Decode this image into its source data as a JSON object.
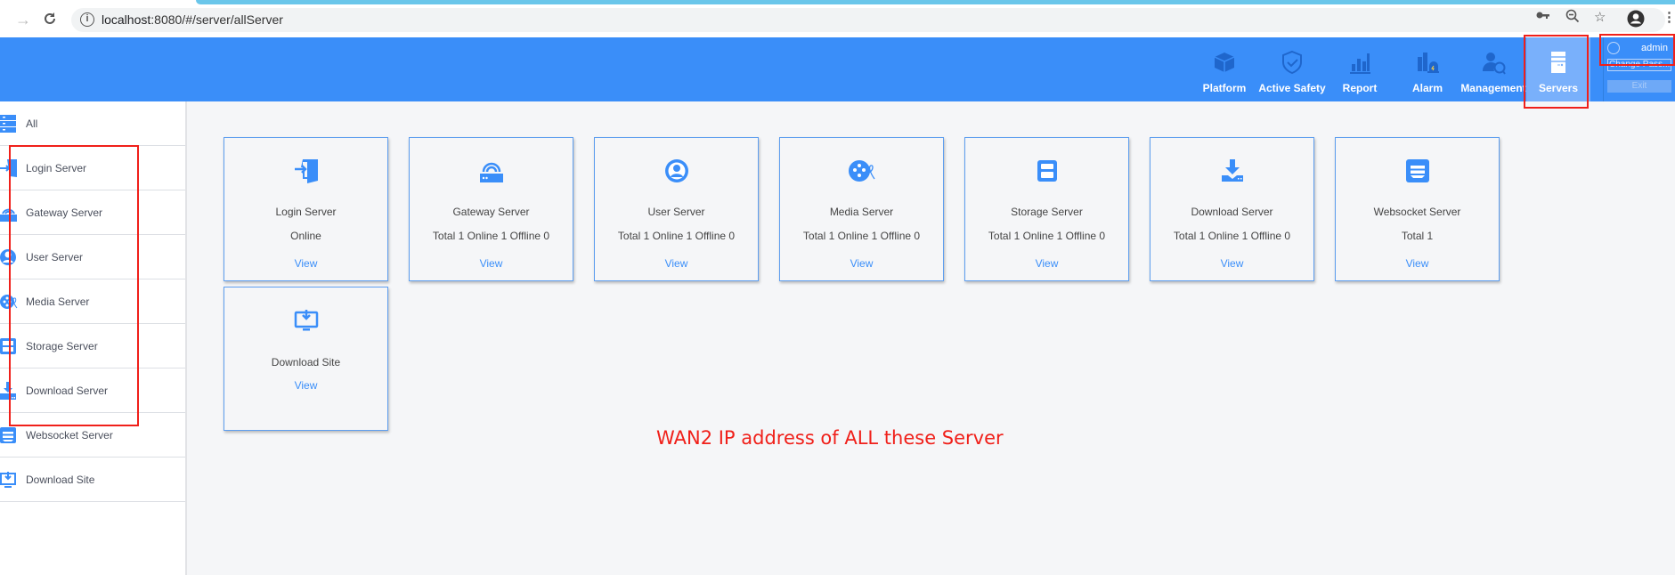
{
  "browser": {
    "url_host": "localhost",
    "url_rest": ":8080/#/server/allServer",
    "icons": [
      "back-arrow-icon",
      "reload-icon",
      "info-icon",
      "key-icon",
      "zoom-out-icon",
      "star-icon",
      "profile-icon",
      "menu-dots-icon"
    ]
  },
  "header": {
    "nav": [
      {
        "label": "Platform",
        "icon": "cube-icon"
      },
      {
        "label": "Active Safety",
        "icon": "shield-check-icon"
      },
      {
        "label": "Report",
        "icon": "bar-chart-icon"
      },
      {
        "label": "Alarm",
        "icon": "alarm-siren-icon"
      },
      {
        "label": "Management",
        "icon": "user-gauge-icon"
      },
      {
        "label": "Servers",
        "icon": "server-icon",
        "active": true
      }
    ],
    "user": {
      "name": "admin",
      "change_password": "Change Pass...",
      "exit": "Exit"
    }
  },
  "sidebar": {
    "items": [
      {
        "label": "All",
        "icon": "all-servers-icon"
      },
      {
        "label": "Login Server",
        "icon": "login-door-icon"
      },
      {
        "label": "Gateway Server",
        "icon": "router-icon"
      },
      {
        "label": "User Server",
        "icon": "user-circle-icon"
      },
      {
        "label": "Media Server",
        "icon": "film-reel-icon"
      },
      {
        "label": "Storage Server",
        "icon": "floppy-icon"
      },
      {
        "label": "Download Server",
        "icon": "download-tray-icon"
      },
      {
        "label": "Websocket Server",
        "icon": "websocket-icon"
      },
      {
        "label": "Download Site",
        "icon": "monitor-download-icon"
      }
    ]
  },
  "cards": [
    {
      "title": "Login Server",
      "status": "Online",
      "view": "View",
      "icon": "login-door-icon"
    },
    {
      "title": "Gateway Server",
      "status": "Total 1 Online 1 Offline 0",
      "view": "View",
      "icon": "router-icon"
    },
    {
      "title": "User Server",
      "status": "Total 1 Online 1 Offline 0",
      "view": "View",
      "icon": "user-circle-icon"
    },
    {
      "title": "Media Server",
      "status": "Total 1 Online 1 Offline 0",
      "view": "View",
      "icon": "film-reel-icon"
    },
    {
      "title": "Storage Server",
      "status": "Total 1 Online 1 Offline 0",
      "view": "View",
      "icon": "floppy-icon"
    },
    {
      "title": "Download Server",
      "status": "Total 1 Online 1 Offline 0",
      "view": "View",
      "icon": "download-tray-icon"
    },
    {
      "title": "Websocket Server",
      "status": "Total 1",
      "view": "View",
      "icon": "websocket-icon"
    },
    {
      "title": "Download Site",
      "view": "View",
      "icon": "monitor-download-icon"
    }
  ],
  "annotation": "WAN2 IP address of ALL these Server",
  "colors": {
    "brand_blue": "#3a8ef9",
    "active_nav": "#79b0fb",
    "annotation_red": "#f0201a"
  }
}
